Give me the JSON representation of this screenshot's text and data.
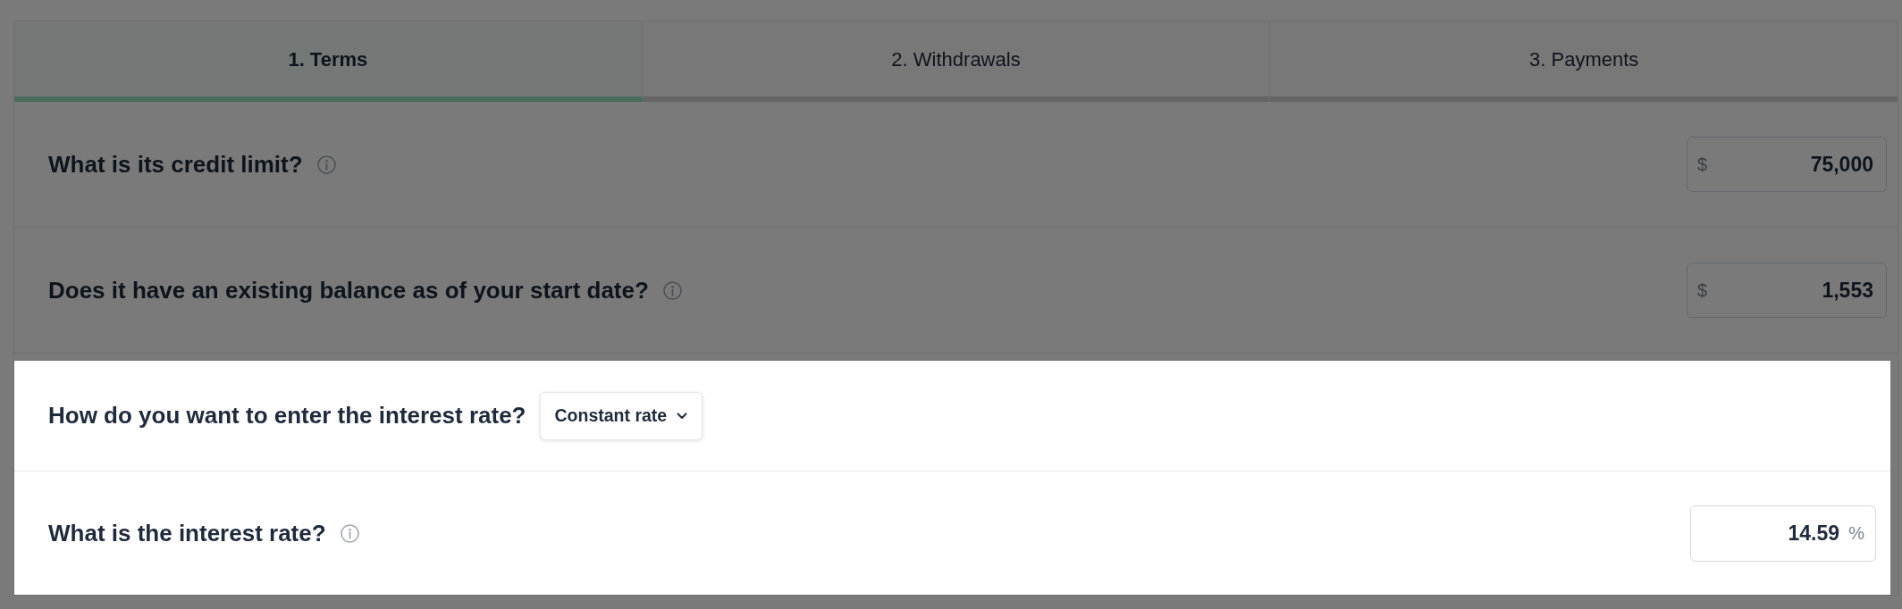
{
  "tabs": [
    {
      "label": "1. Terms",
      "selected": true
    },
    {
      "label": "2. Withdrawals",
      "selected": false
    },
    {
      "label": "3. Payments",
      "selected": false
    }
  ],
  "questions": [
    {
      "kind": "number",
      "label": "What is its credit limit?",
      "info": true,
      "prefix": "$",
      "value": "75,000",
      "highlighted": false
    },
    {
      "kind": "number",
      "label": "Does it have an existing balance as of your start date?",
      "info": true,
      "prefix": "$",
      "value": "1,553",
      "highlighted": false
    },
    {
      "kind": "select",
      "label": "How do you want to enter the interest rate?",
      "info": false,
      "value": "Constant rate",
      "highlighted": true
    },
    {
      "kind": "number",
      "label": "What is the interest rate?",
      "info": true,
      "value": "14.59",
      "suffix": "%",
      "highlighted": true
    }
  ]
}
